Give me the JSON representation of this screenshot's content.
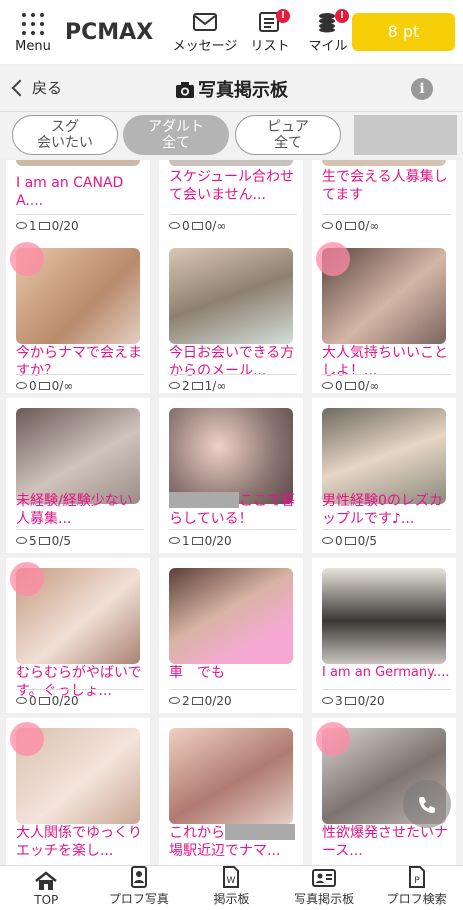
{
  "header": {
    "menu_label": "Menu",
    "logo": "PCMAX",
    "nav": [
      {
        "label": "メッセージ",
        "icon": "envelope-icon"
      },
      {
        "label": "リスト",
        "icon": "list-icon",
        "badge": "!"
      },
      {
        "label": "マイル",
        "icon": "coins-icon",
        "badge": "!"
      }
    ],
    "points": "8 pt",
    "colors": {
      "accent": "#f7cf09",
      "badge": "#e41d3c",
      "post_text": "#e5168a"
    }
  },
  "titlebar": {
    "back_label": "戻る",
    "title": "写真掲示板",
    "info": "i"
  },
  "filters": [
    {
      "line1": "スグ",
      "line2": "会いたい",
      "active": false
    },
    {
      "line1": "アダルト",
      "line2": "全て",
      "active": true
    },
    {
      "line1": "ピュア",
      "line2": "全て",
      "active": false
    }
  ],
  "posts": [
    {
      "text": "I am an CANADA....",
      "views": "1",
      "mails": "0/20"
    },
    {
      "text": "スケジュール合わせて会いません...",
      "views": "0",
      "mails": "0/∞"
    },
    {
      "text": "生で会える人募集してます",
      "views": "0",
      "mails": "0/∞"
    },
    {
      "text": "今からナマで会えますか？",
      "views": "0",
      "mails": "0/∞"
    },
    {
      "text": "今日お会いできる方からのメール...",
      "views": "2",
      "mails": "1/∞"
    },
    {
      "text": "大人気持ちいいことしよ！...",
      "views": "0",
      "mails": "0/∞"
    },
    {
      "text": "未経験/経験少ない人募集...",
      "views": "5",
      "mails": "0/5"
    },
    {
      "text": "ここで暮らしている！",
      "views": "1",
      "mails": "0/20",
      "masked_prefix": true
    },
    {
      "text": "男性経験0のレズカップルです♪...",
      "views": "0",
      "mails": "0/5"
    },
    {
      "text": "むらむらがやばいです。ぐっしょ...",
      "views": "0",
      "mails": "0/20"
    },
    {
      "text": "車　でも",
      "views": "2",
      "mails": "0/20"
    },
    {
      "text": "I am an Germany....",
      "views": "3",
      "mails": "0/20"
    },
    {
      "text": "大人関係でゆっくりエッチを楽し...",
      "views": "",
      "mails": ""
    },
    {
      "text": "これから",
      "text2": "場駅近辺でナマ...",
      "views": "",
      "mails": "",
      "masked_mid": true
    },
    {
      "text": "性欲爆発させたいナース...",
      "views": "",
      "mails": ""
    }
  ],
  "bottom_nav": [
    {
      "label": "TOP",
      "icon": "home-icon"
    },
    {
      "label": "プロフ写真",
      "icon": "profile-photo-icon"
    },
    {
      "label": "掲示板",
      "icon": "board-icon"
    },
    {
      "label": "写真掲示板",
      "icon": "photo-board-icon"
    },
    {
      "label": "プロフ検索",
      "icon": "profile-search-icon"
    }
  ]
}
